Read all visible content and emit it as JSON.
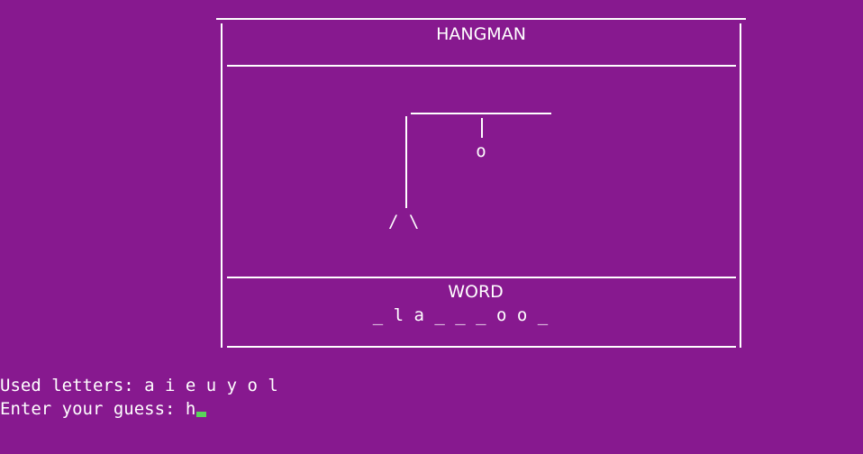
{
  "frame": {
    "title": "HANGMAN",
    "word_heading": "WORD"
  },
  "drawing": {
    "head": "o",
    "legs": "/ \\"
  },
  "word": {
    "display": "_ l a _ _ _ o o _"
  },
  "prompt": {
    "used_letters": "Used letters: a i e u y o l",
    "guess_label": "Enter your guess: ",
    "guess_value": "h"
  },
  "colors": {
    "background": "#87198f",
    "text": "#ffffff",
    "cursor": "#5ad45a"
  }
}
